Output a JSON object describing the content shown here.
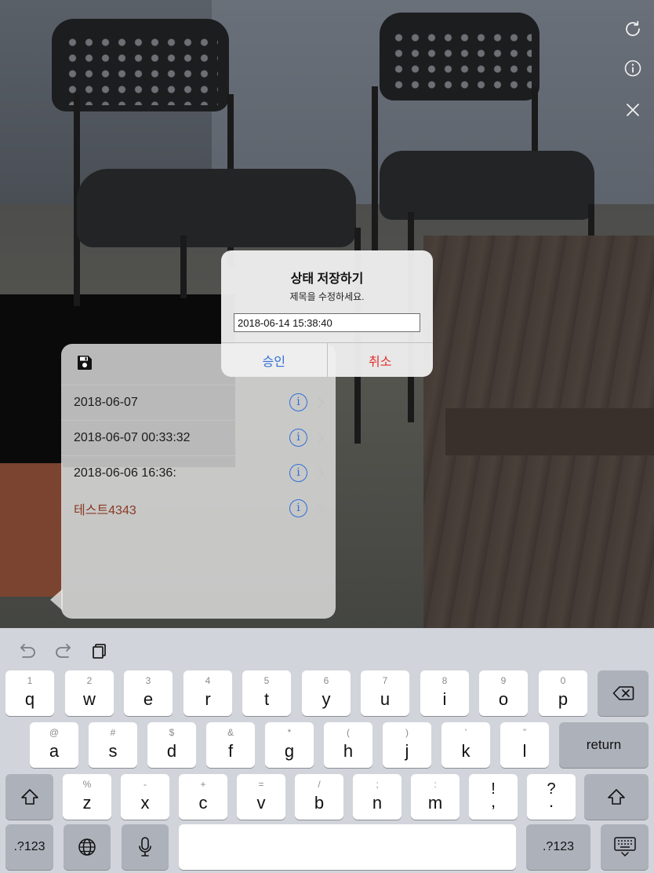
{
  "top_actions": [
    {
      "icon": "refresh-icon"
    },
    {
      "icon": "info-icon"
    },
    {
      "icon": "close-icon"
    }
  ],
  "saved_list": {
    "header_icon": "save-icon",
    "items": [
      {
        "label": "2018-06-07",
        "color": "#1b1b1b"
      },
      {
        "label": "2018-06-07 00:33:32",
        "color": "#1b1b1b"
      },
      {
        "label": "2018-06-06 16:36:",
        "color": "#1b1b1b"
      },
      {
        "label": "테스트4343",
        "color": "#8a3a22"
      }
    ]
  },
  "alert": {
    "title": "상태 저장하기",
    "message": "제목을 수정하세요.",
    "input_value": "2018-06-14 15:38:40",
    "ok_label": "승인",
    "cancel_label": "취소",
    "ok_color": "#2f6fd6",
    "cancel_color": "#e0302b"
  },
  "keyboard": {
    "shortcuts": [
      "undo-icon",
      "redo-icon",
      "paste-icon"
    ],
    "row1": [
      {
        "hint": "1",
        "key": "q"
      },
      {
        "hint": "2",
        "key": "w"
      },
      {
        "hint": "3",
        "key": "e"
      },
      {
        "hint": "4",
        "key": "r"
      },
      {
        "hint": "5",
        "key": "t"
      },
      {
        "hint": "6",
        "key": "y"
      },
      {
        "hint": "7",
        "key": "u"
      },
      {
        "hint": "8",
        "key": "i"
      },
      {
        "hint": "9",
        "key": "o"
      },
      {
        "hint": "0",
        "key": "p"
      }
    ],
    "row2": [
      {
        "hint": "@",
        "key": "a"
      },
      {
        "hint": "#",
        "key": "s"
      },
      {
        "hint": "$",
        "key": "d"
      },
      {
        "hint": "&",
        "key": "f"
      },
      {
        "hint": "*",
        "key": "g"
      },
      {
        "hint": "(",
        "key": "h"
      },
      {
        "hint": ")",
        "key": "j"
      },
      {
        "hint": "’",
        "key": "k"
      },
      {
        "hint": "”",
        "key": "l"
      }
    ],
    "row3": [
      {
        "hint": "%",
        "key": "z"
      },
      {
        "hint": "-",
        "key": "x"
      },
      {
        "hint": "+",
        "key": "c"
      },
      {
        "hint": "=",
        "key": "v"
      },
      {
        "hint": "/",
        "key": "b"
      },
      {
        "hint": ";",
        "key": "n"
      },
      {
        "hint": ":",
        "key": "m"
      },
      {
        "hint": "!",
        "key": ","
      },
      {
        "hint": "?",
        "key": "."
      }
    ],
    "return_label": "return",
    "numbers_label": ".?123",
    "numbers_label_right": ".?123"
  }
}
